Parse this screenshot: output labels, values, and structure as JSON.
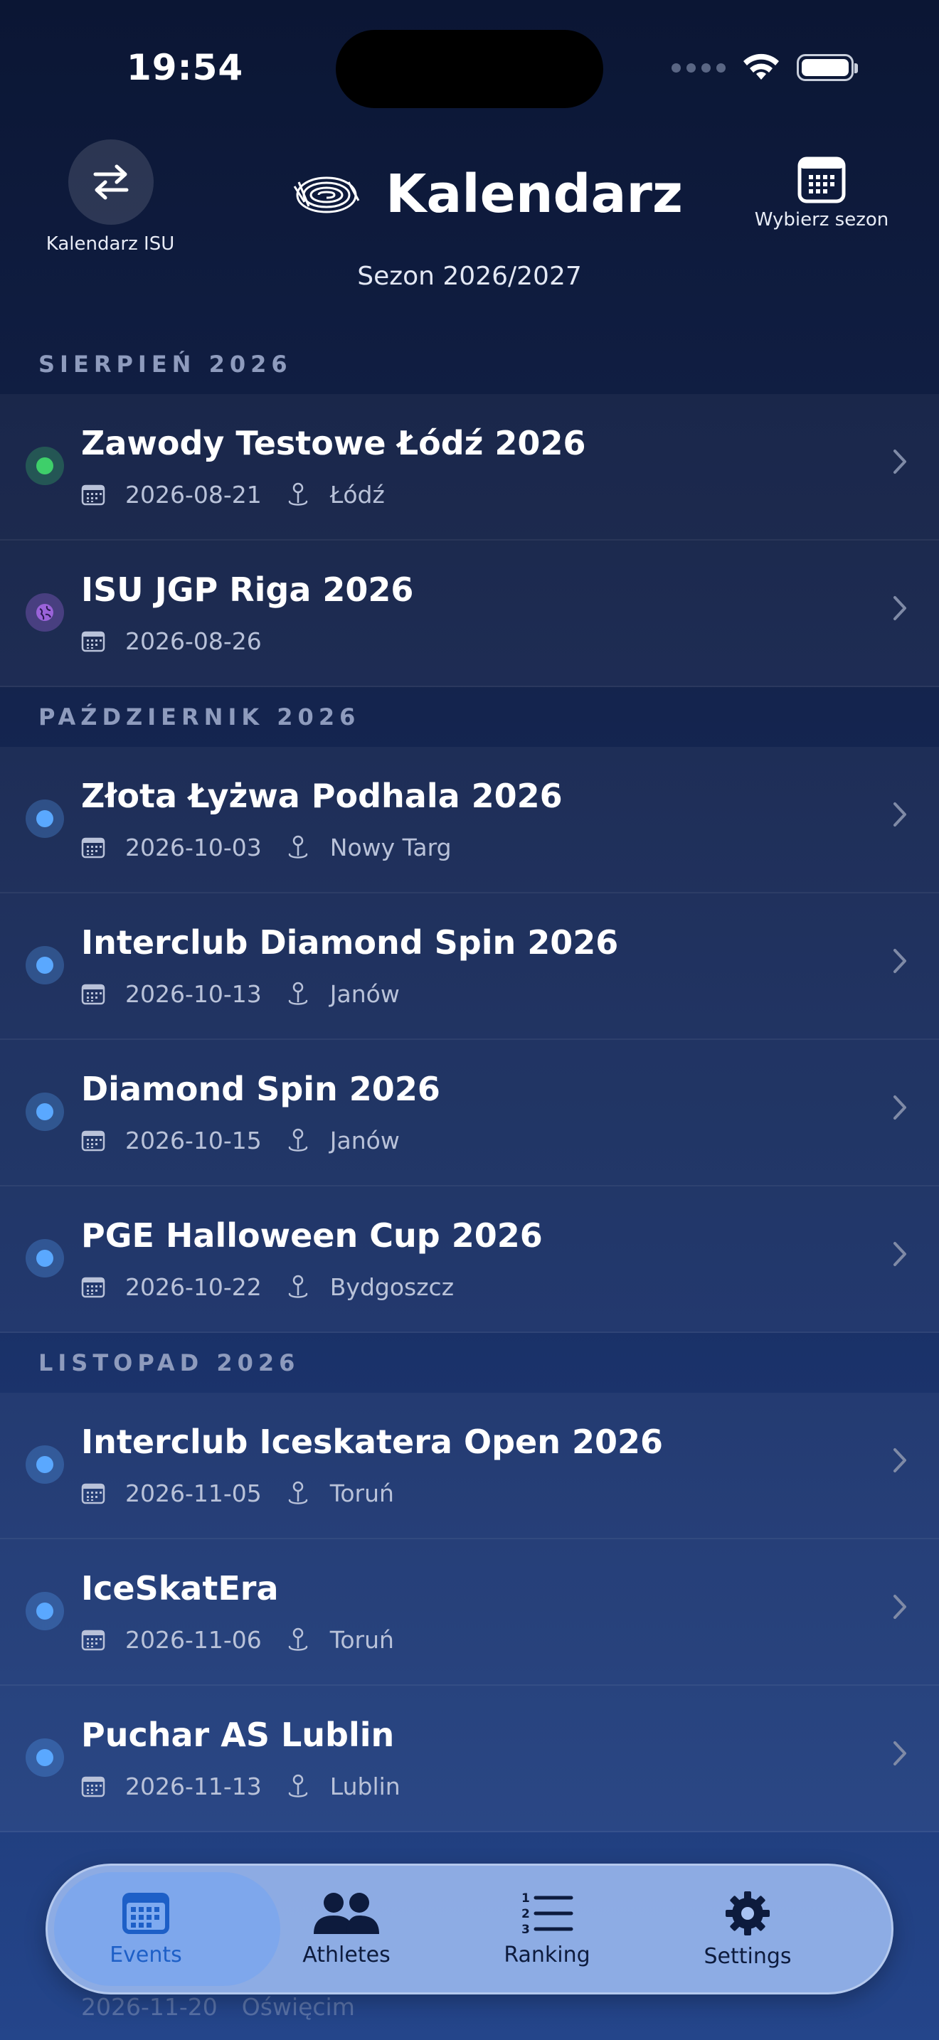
{
  "status_bar": {
    "time": "19:54"
  },
  "header": {
    "isu_button_label": "Kalendarz ISU",
    "title": "Kalendarz",
    "season": "Sezon 2026/2027",
    "season_button_label": "Wybierz sezon"
  },
  "sections": [
    {
      "title": "SIERPIEŃ 2026",
      "events": [
        {
          "name": "Zawody Testowe Łódź 2026",
          "date": "2026-08-21",
          "location": "Łódź",
          "status": "green"
        },
        {
          "name": "ISU JGP Riga 2026",
          "date": "2026-08-26",
          "location": "",
          "status": "international"
        }
      ]
    },
    {
      "title": "PAŹDZIERNIK 2026",
      "events": [
        {
          "name": "Złota Łyżwa Podhala 2026",
          "date": "2026-10-03",
          "location": "Nowy Targ",
          "status": "blue"
        },
        {
          "name": "Interclub Diamond Spin 2026",
          "date": "2026-10-13",
          "location": "Janów",
          "status": "blue"
        },
        {
          "name": "Diamond Spin 2026",
          "date": "2026-10-15",
          "location": "Janów",
          "status": "blue"
        },
        {
          "name": "PGE Halloween Cup 2026",
          "date": "2026-10-22",
          "location": "Bydgoszcz",
          "status": "blue"
        }
      ]
    },
    {
      "title": "LISTOPAD 2026",
      "events": [
        {
          "name": "Interclub Iceskatera Open 2026",
          "date": "2026-11-05",
          "location": "Toruń",
          "status": "blue"
        },
        {
          "name": "IceSkatEra",
          "date": "2026-11-06",
          "location": "Toruń",
          "status": "blue"
        },
        {
          "name": "Puchar AS Lublin",
          "date": "2026-11-13",
          "location": "Lublin",
          "status": "blue"
        }
      ]
    }
  ],
  "peek_event": {
    "date": "2026-11-20",
    "location": "Oświęcim"
  },
  "tabs": [
    {
      "label": "Events",
      "icon": "calendar-icon",
      "active": true
    },
    {
      "label": "Athletes",
      "icon": "people-icon",
      "active": false
    },
    {
      "label": "Ranking",
      "icon": "numbered-list-icon",
      "active": false
    },
    {
      "label": "Settings",
      "icon": "gear-icon",
      "active": false
    }
  ],
  "colors": {
    "status_green": "#3ecf6a",
    "status_blue": "#5aa8ff",
    "status_international": "#9a63d9",
    "tab_active": "#1d5fc7"
  }
}
